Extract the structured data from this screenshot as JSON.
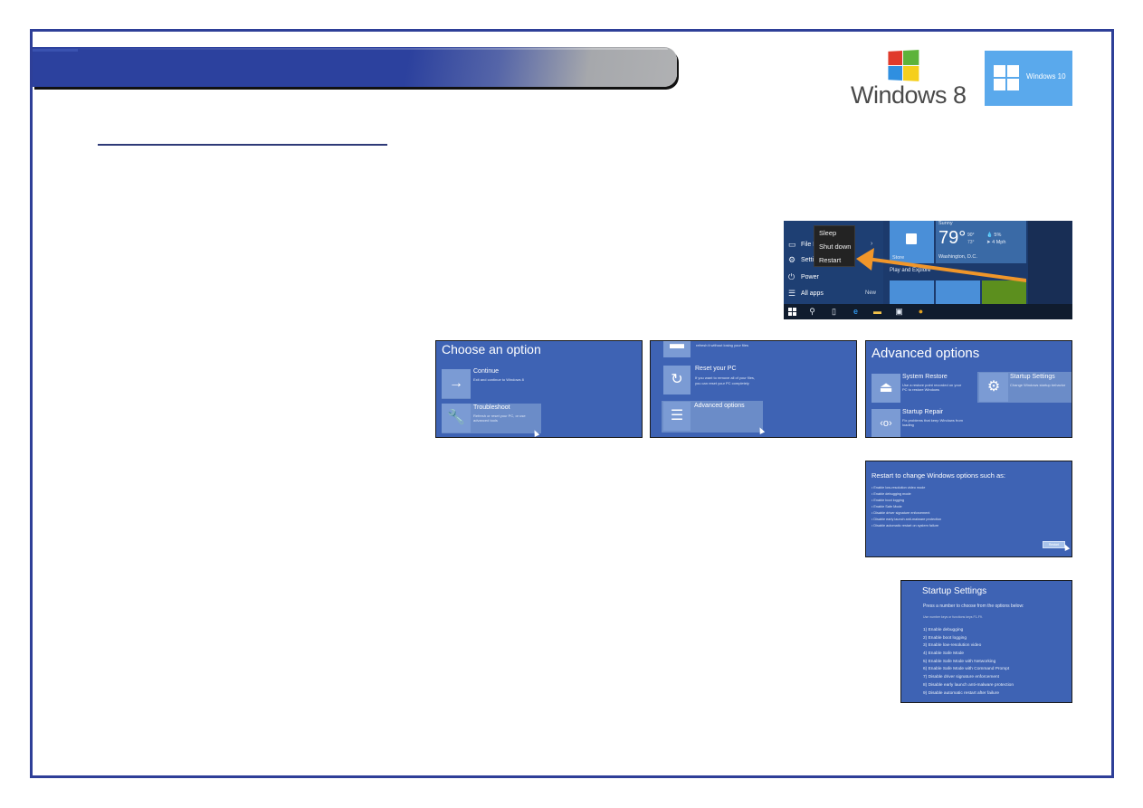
{
  "colors": {
    "frame": "#2e3f98",
    "header_bar": "#2c419e",
    "recovery_blue": "#3e63b4",
    "win10_badge": "#5aa9ec",
    "arrow": "#f0962a"
  },
  "logos": {
    "windows8": "Windows 8",
    "windows10": "Windows 10"
  },
  "start_menu": {
    "left_items": [
      {
        "icon": "file-explorer-icon",
        "label": "File E"
      },
      {
        "icon": "settings-icon",
        "label": "Settin"
      },
      {
        "icon": "power-icon",
        "label": "Power"
      },
      {
        "icon": "all-apps-icon",
        "label": "All apps"
      }
    ],
    "new_badge": "New",
    "power_menu": [
      "Sleep",
      "Shut down",
      "Restart"
    ],
    "store_tile": "Store",
    "weather": {
      "condition": "Sunny",
      "temperature": "79°",
      "high": "90°",
      "low": "73°",
      "precip": "5%",
      "wind": "4 Mph",
      "city": "Washington, D.C."
    },
    "group_label": "Play and Explore",
    "taskbar": [
      "start-icon",
      "search-icon",
      "task-view-icon",
      "edge-icon",
      "file-explorer-icon",
      "store-icon",
      "chrome-icon"
    ]
  },
  "screens": {
    "choose_option": {
      "title": "Choose an option",
      "options": [
        {
          "title": "Continue",
          "desc": "Exit and continue to Windows 8"
        },
        {
          "title": "Troubleshoot",
          "desc_line1": "Refresh or reset your PC, or use",
          "desc_line2": "advanced tools"
        }
      ]
    },
    "troubleshoot": {
      "refresh_desc": "refresh it without losing your files",
      "options": [
        {
          "title": "Reset your PC",
          "desc_line1": "If you want to remove all of your files,",
          "desc_line2": "you can reset your PC completely"
        },
        {
          "title": "Advanced options"
        }
      ]
    },
    "advanced_options": {
      "title": "Advanced options",
      "options": [
        {
          "title": "System Restore",
          "desc_line1": "Use a restore point recorded on your",
          "desc_line2": "PC to restore Windows"
        },
        {
          "title": "Startup Settings",
          "desc_line1": "Change Windows startup behavior"
        },
        {
          "title": "Startup Repair",
          "desc_line1": "Fix problems that keep Windows from",
          "desc_line2": "loading"
        }
      ]
    },
    "restart_options": {
      "title": "Restart to change Windows options such as:",
      "items": [
        "Enable low-resolution video mode",
        "Enable debugging mode",
        "Enable boot logging",
        "Enable Safe Mode",
        "Disable driver signature enforcement",
        "Disable early launch anti-malware protection",
        "Disable automatic restart on system failure"
      ],
      "button": "Restart"
    },
    "startup_settings": {
      "title": "Startup Settings",
      "subtitle": "Press a number to choose from the options below:",
      "hint": "Use number keys or functions keys F1-F9.",
      "items": [
        "1) Enable debugging",
        "2) Enable boot logging",
        "3) Enable low-resolution video",
        "4) Enable Safe Mode",
        "5) Enable Safe Mode with Networking",
        "6) Enable Safe Mode with Command Prompt",
        "7) Disable driver signature enforcement",
        "8) Disable early launch anti-malware protection",
        "9) Disable automatic restart after failure"
      ]
    }
  }
}
